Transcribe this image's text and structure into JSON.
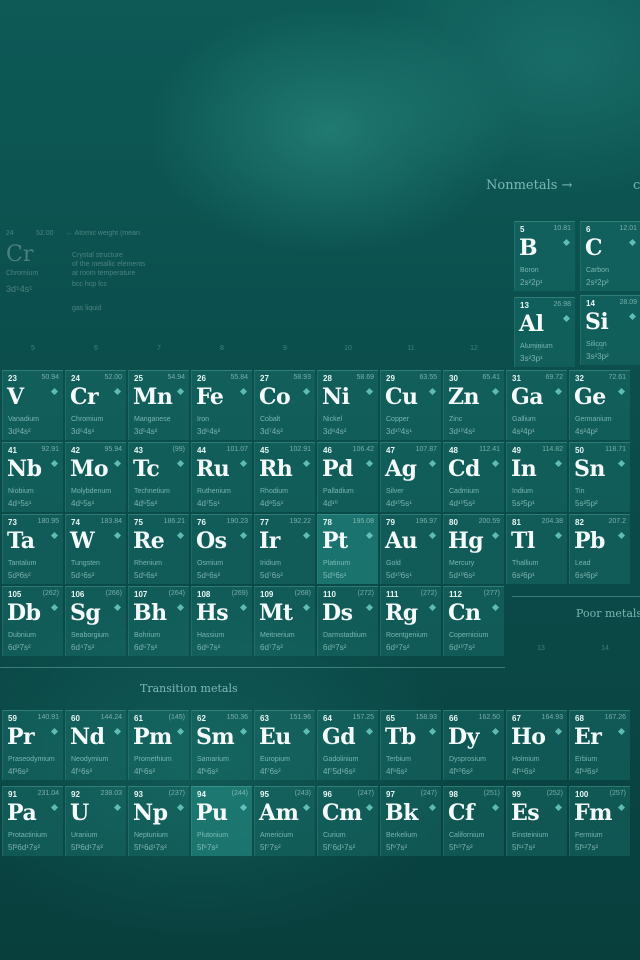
{
  "labels": {
    "nonmetals": "Nonmetals →",
    "transition_metals": "Transition metals",
    "poor_metals": "Poor metals",
    "corner": "c"
  },
  "legend": {
    "number": "24",
    "mass": "52.00",
    "symbol": "Cr",
    "name": "Chromium",
    "config": "3d⁵4s¹",
    "mass_note": "← Atomic weight (mean",
    "crystal_note": "Crystal structure",
    "crystal_note2": "of the metallic elements",
    "crystal_note3": "at room temperature",
    "lattices": "bcc   hcp   fcc",
    "state": "gas   liquid"
  },
  "group_numbers": [
    "5",
    "6",
    "7",
    "8",
    "9",
    "10",
    "11",
    "12",
    "13",
    "14"
  ],
  "main_rows": [
    [
      {
        "n": "23",
        "m": "50.94",
        "s": "V",
        "name": "Vanadium",
        "cfg": "3d³4s²"
      },
      {
        "n": "24",
        "m": "52.00",
        "s": "Cr",
        "name": "Chromium",
        "cfg": "3d⁵4s¹"
      },
      {
        "n": "25",
        "m": "54.94",
        "s": "Mn",
        "name": "Manganese",
        "cfg": "3d⁵4s²"
      },
      {
        "n": "26",
        "m": "55.84",
        "s": "Fe",
        "name": "Iron",
        "cfg": "3d⁶4s²"
      },
      {
        "n": "27",
        "m": "58.93",
        "s": "Co",
        "name": "Cobalt",
        "cfg": "3d⁷4s²"
      },
      {
        "n": "28",
        "m": "58.69",
        "s": "Ni",
        "name": "Nickel",
        "cfg": "3d⁸4s²"
      },
      {
        "n": "29",
        "m": "63.55",
        "s": "Cu",
        "name": "Copper",
        "cfg": "3d¹⁰4s¹"
      },
      {
        "n": "30",
        "m": "65.41",
        "s": "Zn",
        "name": "Zinc",
        "cfg": "3d¹⁰4s²"
      },
      {
        "n": "31",
        "m": "69.72",
        "s": "Ga",
        "name": "Gallium",
        "cfg": "4s²4p¹"
      },
      {
        "n": "32",
        "m": "72.61",
        "s": "Ge",
        "name": "Germanium",
        "cfg": "4s²4p²"
      }
    ],
    [
      {
        "n": "41",
        "m": "92.91",
        "s": "Nb",
        "name": "Niobium",
        "cfg": "4d⁴5s¹"
      },
      {
        "n": "42",
        "m": "95.94",
        "s": "Mo",
        "name": "Molybdenum",
        "cfg": "4d⁵5s¹"
      },
      {
        "n": "43",
        "m": "(99)",
        "s": "Tc",
        "name": "Technetium",
        "cfg": "4d⁵5s²"
      },
      {
        "n": "44",
        "m": "101.07",
        "s": "Ru",
        "name": "Ruthenium",
        "cfg": "4d⁷5s¹"
      },
      {
        "n": "45",
        "m": "102.91",
        "s": "Rh",
        "name": "Rhodium",
        "cfg": "4d⁸5s¹"
      },
      {
        "n": "46",
        "m": "106.42",
        "s": "Pd",
        "name": "Palladium",
        "cfg": "4d¹⁰"
      },
      {
        "n": "47",
        "m": "107.87",
        "s": "Ag",
        "name": "Silver",
        "cfg": "4d¹⁰5s¹"
      },
      {
        "n": "48",
        "m": "112.41",
        "s": "Cd",
        "name": "Cadmium",
        "cfg": "4d¹⁰5s²"
      },
      {
        "n": "49",
        "m": "114.82",
        "s": "In",
        "name": "Indium",
        "cfg": "5s²5p¹"
      },
      {
        "n": "50",
        "m": "118.71",
        "s": "Sn",
        "name": "Tin",
        "cfg": "5s²5p²"
      }
    ],
    [
      {
        "n": "73",
        "m": "180.95",
        "s": "Ta",
        "name": "Tantalum",
        "cfg": "5d³6s²"
      },
      {
        "n": "74",
        "m": "183.84",
        "s": "W",
        "name": "Tungsten",
        "cfg": "5d⁴6s²"
      },
      {
        "n": "75",
        "m": "186.21",
        "s": "Re",
        "name": "Rhenium",
        "cfg": "5d⁵6s²"
      },
      {
        "n": "76",
        "m": "190.23",
        "s": "Os",
        "name": "Osmium",
        "cfg": "5d⁶6s²"
      },
      {
        "n": "77",
        "m": "192.22",
        "s": "Ir",
        "name": "Iridium",
        "cfg": "5d⁷6s²"
      },
      {
        "n": "78",
        "m": "195.08",
        "s": "Pt",
        "name": "Platinum",
        "cfg": "5d⁹6s¹"
      },
      {
        "n": "79",
        "m": "196.97",
        "s": "Au",
        "name": "Gold",
        "cfg": "5d¹⁰6s¹"
      },
      {
        "n": "80",
        "m": "200.59",
        "s": "Hg",
        "name": "Mercury",
        "cfg": "5d¹⁰6s²"
      },
      {
        "n": "81",
        "m": "204.38",
        "s": "Tl",
        "name": "Thallium",
        "cfg": "6s²6p¹"
      },
      {
        "n": "82",
        "m": "207.2",
        "s": "Pb",
        "name": "Lead",
        "cfg": "6s²6p²"
      }
    ],
    [
      {
        "n": "105",
        "m": "(262)",
        "s": "Db",
        "name": "Dubnium",
        "cfg": "6d³7s²"
      },
      {
        "n": "106",
        "m": "(266)",
        "s": "Sg",
        "name": "Seaborgium",
        "cfg": "6d⁴7s²"
      },
      {
        "n": "107",
        "m": "(264)",
        "s": "Bh",
        "name": "Bohrium",
        "cfg": "6d⁵7s²"
      },
      {
        "n": "108",
        "m": "(269)",
        "s": "Hs",
        "name": "Hassium",
        "cfg": "6d⁶7s²"
      },
      {
        "n": "109",
        "m": "(268)",
        "s": "Mt",
        "name": "Meitnerium",
        "cfg": "6d⁷7s²"
      },
      {
        "n": "110",
        "m": "(272)",
        "s": "Ds",
        "name": "Darmstadtium",
        "cfg": "6d⁸7s²"
      },
      {
        "n": "111",
        "m": "(272)",
        "s": "Rg",
        "name": "Roentgenium",
        "cfg": "6d⁹7s²"
      },
      {
        "n": "112",
        "m": "(277)",
        "s": "Cn",
        "name": "Copernicium",
        "cfg": "6d¹⁰7s²"
      }
    ]
  ],
  "top_cells": [
    {
      "n": "5",
      "m": "10.81",
      "s": "B",
      "name": "Boron",
      "cfg": "2s²2p¹"
    },
    {
      "n": "6",
      "m": "12.01",
      "s": "C",
      "name": "Carbon",
      "cfg": "2s²2p²"
    },
    {
      "n": "13",
      "m": "26.98",
      "s": "Al",
      "name": "Aluminium",
      "cfg": "3s²3p¹"
    },
    {
      "n": "14",
      "m": "28.09",
      "s": "Si",
      "name": "Silicon",
      "cfg": "3s²3p²"
    }
  ],
  "poor_numbers": [
    "13",
    "14"
  ],
  "lanthanides": [
    {
      "n": "59",
      "m": "140.91",
      "s": "Pr",
      "name": "Praseodymium",
      "cfg": "4f³6s²"
    },
    {
      "n": "60",
      "m": "144.24",
      "s": "Nd",
      "name": "Neodymium",
      "cfg": "4f⁴6s²"
    },
    {
      "n": "61",
      "m": "(145)",
      "s": "Pm",
      "name": "Promethium",
      "cfg": "4f⁵6s²"
    },
    {
      "n": "62",
      "m": "150.36",
      "s": "Sm",
      "name": "Samarium",
      "cfg": "4f⁶6s²"
    },
    {
      "n": "63",
      "m": "151.96",
      "s": "Eu",
      "name": "Europium",
      "cfg": "4f⁷6s²"
    },
    {
      "n": "64",
      "m": "157.25",
      "s": "Gd",
      "name": "Gadolinium",
      "cfg": "4f⁷5d¹6s²"
    },
    {
      "n": "65",
      "m": "158.93",
      "s": "Tb",
      "name": "Terbium",
      "cfg": "4f⁹6s²"
    },
    {
      "n": "66",
      "m": "162.50",
      "s": "Dy",
      "name": "Dysprosium",
      "cfg": "4f¹⁰6s²"
    },
    {
      "n": "67",
      "m": "164.93",
      "s": "Ho",
      "name": "Holmium",
      "cfg": "4f¹¹6s²"
    },
    {
      "n": "68",
      "m": "167.26",
      "s": "Er",
      "name": "Erbium",
      "cfg": "4f¹²6s²"
    }
  ],
  "actinides": [
    {
      "n": "91",
      "m": "231.04",
      "s": "Pa",
      "name": "Protactinium",
      "cfg": "5f²6d¹7s²"
    },
    {
      "n": "92",
      "m": "238.03",
      "s": "U",
      "name": "Uranium",
      "cfg": "5f³6d¹7s²"
    },
    {
      "n": "93",
      "m": "(237)",
      "s": "Np",
      "name": "Neptunium",
      "cfg": "5f⁴6d¹7s²"
    },
    {
      "n": "94",
      "m": "(244)",
      "s": "Pu",
      "name": "Plutonium",
      "cfg": "5f⁶7s²"
    },
    {
      "n": "95",
      "m": "(243)",
      "s": "Am",
      "name": "Americium",
      "cfg": "5f⁷7s²"
    },
    {
      "n": "96",
      "m": "(247)",
      "s": "Cm",
      "name": "Curium",
      "cfg": "5f⁷6d¹7s²"
    },
    {
      "n": "97",
      "m": "(247)",
      "s": "Bk",
      "name": "Berkelium",
      "cfg": "5f⁹7s²"
    },
    {
      "n": "98",
      "m": "(251)",
      "s": "Cf",
      "name": "Californium",
      "cfg": "5f¹⁰7s²"
    },
    {
      "n": "99",
      "m": "(252)",
      "s": "Es",
      "name": "Einsteinium",
      "cfg": "5f¹¹7s²"
    },
    {
      "n": "100",
      "m": "(257)",
      "s": "Fm",
      "name": "Fermium",
      "cfg": "5f¹²7s²"
    }
  ]
}
